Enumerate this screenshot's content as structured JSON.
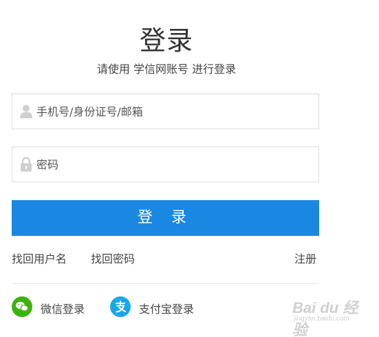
{
  "header": {
    "title": "登录",
    "subtitle": "请使用 学信网账号 进行登录"
  },
  "form": {
    "username": {
      "placeholder": "手机号/身份证号/邮箱",
      "value": "",
      "icon": "user-icon"
    },
    "password": {
      "placeholder": "密码",
      "value": "",
      "icon": "lock-icon"
    },
    "submit_label": "登 录"
  },
  "links": {
    "find_username": "找回用户名",
    "find_password": "找回密码",
    "register": "注册"
  },
  "social": {
    "wechat": {
      "label": "微信登录",
      "icon": "wechat-icon",
      "color": "#3bb30f"
    },
    "alipay": {
      "label": "支付宝登录",
      "icon": "alipay-icon",
      "color": "#19a7e9"
    }
  },
  "colors": {
    "primary": "#1a88e3",
    "border": "#dcdcdc"
  },
  "watermark": {
    "brand": "Bai du 经验",
    "url": "jingyan.baidu.com"
  }
}
